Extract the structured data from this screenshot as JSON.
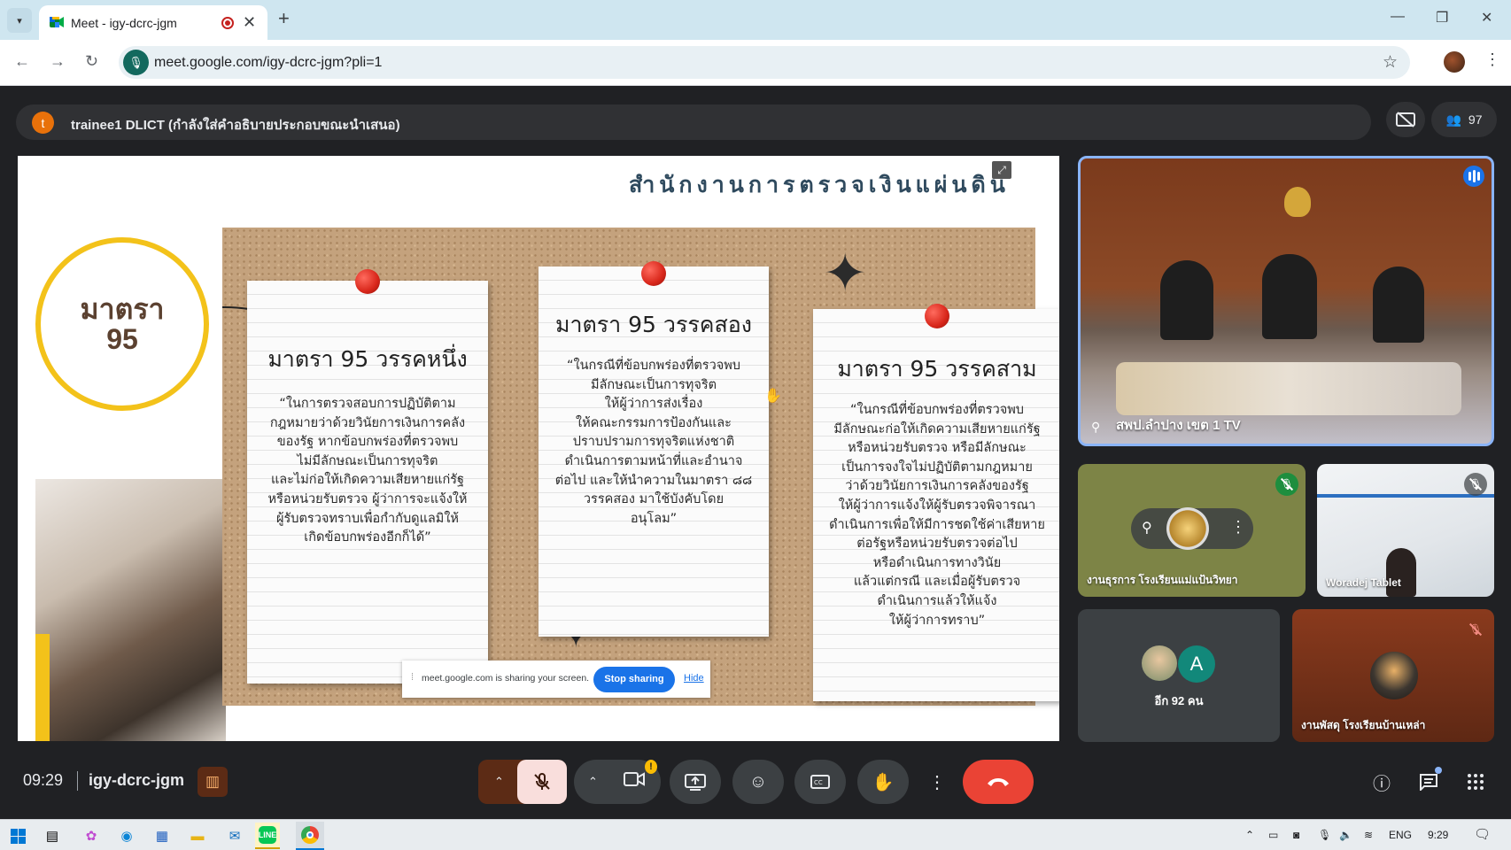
{
  "browser": {
    "tab_title": "Meet - igy-dcrc-jgm",
    "tab_close": "✕",
    "new_tab": "+",
    "url": "meet.google.com/igy-dcrc-jgm?pli=1",
    "window_controls": {
      "minimize": "—",
      "restore": "❐",
      "close": "✕"
    }
  },
  "meet": {
    "presenter_initial": "t",
    "presenter_label": "trainee1 DLICT (กำลังใส่คำอธิบายประกอบขณะนำเสนอ)",
    "participant_count": "97",
    "clock": "09:29",
    "meeting_code": "igy-dcrc-jgm"
  },
  "slide": {
    "header": "สำนักงานการตรวจเงินแผ่นดิน",
    "circle_line1": "มาตรา",
    "circle_line2": "95",
    "notes": [
      {
        "title": "มาตรา 95 วรรคหนึ่ง",
        "body": "“ในการตรวจสอบการปฏิบัติตาม\nกฎหมายว่าด้วยวินัยการเงินการคลัง\nของรัฐ หากข้อบกพร่องที่ตรวจพบ\nไม่มีลักษณะเป็นการทุจริต\nและไม่ก่อให้เกิดความเสียหายแก่รัฐ\nหรือหน่วยรับตรวจ ผู้ว่าการจะแจ้งให้\nผู้รับตรวจทราบเพื่อกำกับดูแลมิให้\nเกิดข้อบกพร่องอีกก็ได้”"
      },
      {
        "title": "มาตรา 95 วรรคสอง",
        "body": "“ในกรณีที่ข้อบกพร่องที่ตรวจพบ\nมีลักษณะเป็นการทุจริต\nให้ผู้ว่าการส่งเรื่อง\nให้คณะกรรมการป้องกันและ\nปราบปรามการทุจริตแห่งชาติ\nดำเนินการตามหน้าที่และอำนาจ\nต่อไป และให้นำความในมาตรา ๘๘\nวรรคสอง มาใช้บังคับโดย\nอนุโลม”"
      },
      {
        "title": "มาตรา 95 วรรคสาม",
        "body": "“ในกรณีที่ข้อบกพร่องที่ตรวจพบ\nมีลักษณะก่อให้เกิดความเสียหายแก่รัฐ\nหรือหน่วยรับตรวจ หรือมีลักษณะ\nเป็นการจงใจไม่ปฏิบัติตามกฎหมาย\nว่าด้วยวินัยการเงินการคลังของรัฐ\nให้ผู้ว่าการแจ้งให้ผู้รับตรวจพิจารณา\nดำเนินการเพื่อให้มีการชดใช้ค่าเสียหาย\nต่อรัฐหรือหน่วยรับตรวจต่อไป\nหรือดำเนินการทางวินัย\nแล้วแต่กรณี และเมื่อผู้รับตรวจ\nดำเนินการแล้วให้แจ้ง\nให้ผู้ว่าการทราบ”"
      }
    ],
    "share_notice": "meet.google.com is sharing your screen.",
    "stop_sharing": "Stop sharing",
    "hide": "Hide"
  },
  "tiles": {
    "main": {
      "name": "สพป.ลำปาง เขต 1 TV"
    },
    "t2": {
      "name": "งานธุรการ โรงเรียนแม่แป้นวิทยา"
    },
    "t3": {
      "name": "Woradej Tablet"
    },
    "others": {
      "avatar_letter": "A",
      "label": "อีก 92 คน"
    },
    "t5": {
      "name": "งานพัสดุ โรงเรียนบ้านเหล่า"
    }
  },
  "taskbar": {
    "lang": "ENG",
    "time": "9:29"
  },
  "colors": {
    "meet_bg": "#202124",
    "end_call": "#ea4335",
    "mic_off_bg": "#f9dedc",
    "accent_blue": "#1a73e8",
    "slide_yellow": "#f3c21a"
  },
  "icons": [
    "tab-search-icon",
    "meet-favicon",
    "recording-icon",
    "back-icon",
    "forward-icon",
    "reload-icon",
    "site-info-icon",
    "star-icon",
    "profile-avatar",
    "more-icon",
    "captions-off-icon",
    "people-icon",
    "mic-off-icon",
    "camera-icon",
    "present-icon",
    "emoji-icon",
    "captions-icon",
    "raise-hand-icon",
    "end-call-icon",
    "info-icon",
    "chat-icon",
    "activities-icon",
    "pin-icon"
  ]
}
